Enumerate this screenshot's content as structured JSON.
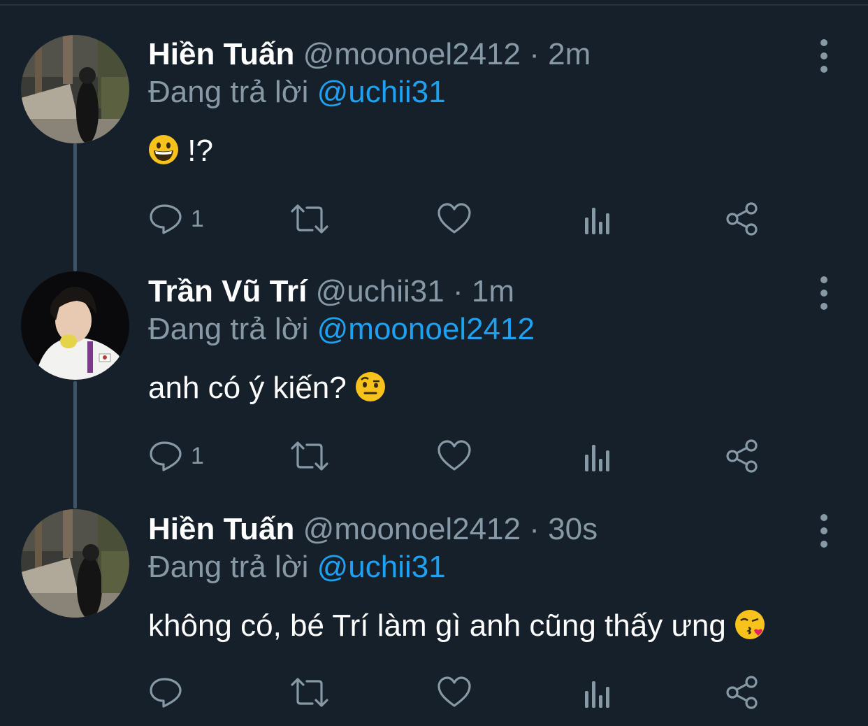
{
  "colors": {
    "background": "#15202b",
    "secondary_text": "#8899a6",
    "link": "#1da1f2",
    "thread_line": "#3d5466"
  },
  "tweets": [
    {
      "name": "Hiền Tuấn",
      "handle": "@moonoel2412",
      "separator": "·",
      "time": "2m",
      "reply_prefix": "Đang trả lời",
      "reply_to": "@uchii31",
      "text": "!?",
      "emoji": "grinning-face",
      "reply_count": "1",
      "avatar": "street-photo"
    },
    {
      "name": "Trần Vũ Trí",
      "handle": "@uchii31",
      "separator": "·",
      "time": "1m",
      "reply_prefix": "Đang trả lời",
      "reply_to": "@moonoel2412",
      "text": "anh có ý kiến?",
      "emoji": "raised-eyebrow-face",
      "reply_count": "1",
      "avatar": "portrait-photo"
    },
    {
      "name": "Hiền Tuấn",
      "handle": "@moonoel2412",
      "separator": "·",
      "time": "30s",
      "reply_prefix": "Đang trả lời",
      "reply_to": "@uchii31",
      "text": "không có, bé Trí làm gì anh cũng thấy ưng",
      "emoji": "face-blowing-kiss",
      "reply_count": "",
      "avatar": "street-photo"
    }
  ],
  "action_icons": [
    "reply-icon",
    "retweet-icon",
    "like-icon",
    "analytics-icon",
    "share-icon"
  ]
}
